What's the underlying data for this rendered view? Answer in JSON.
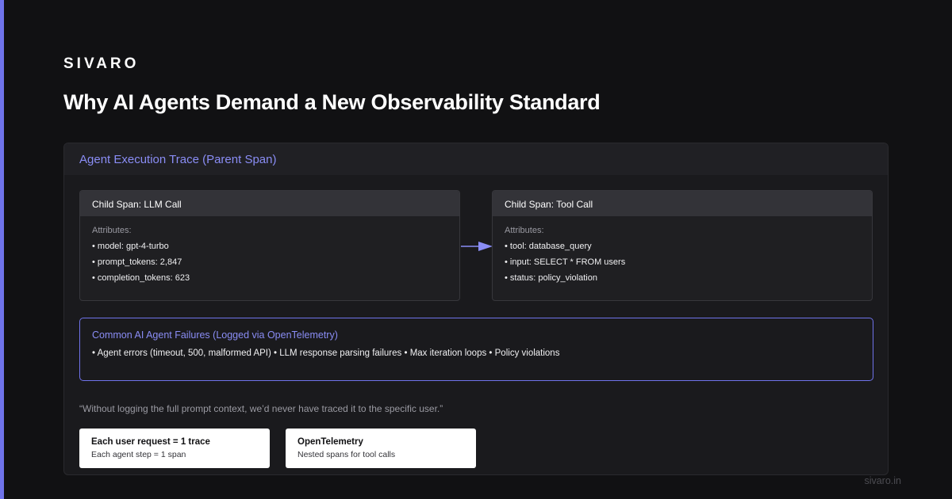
{
  "brand": "SIVARO",
  "headline": "Why AI Agents Demand a New Observability Standard",
  "parent_span": {
    "title": "Agent Execution Trace (Parent Span)"
  },
  "llm_span": {
    "title": "Child Span: LLM Call",
    "attributes_label": "Attributes:",
    "attributes": [
      "• model: gpt-4-turbo",
      "• prompt_tokens: 2,847",
      "• completion_tokens: 623"
    ]
  },
  "tool_span": {
    "title": "Child Span: Tool Call",
    "attributes_label": "Attributes:",
    "attributes": [
      "• tool: database_query",
      "• input: SELECT * FROM users",
      "• status: policy_violation"
    ]
  },
  "failures": {
    "title": "Common AI Agent Failures (Logged via OpenTelemetry)",
    "items": "• Agent errors (timeout, 500, malformed API) • LLM response parsing failures • Max iteration loops • Policy violations"
  },
  "quote": "“Without logging the full prompt context, we’d never have traced it to the specific user.”",
  "cards": [
    {
      "title": "Each user request = 1 trace",
      "subtitle": "Each agent step = 1 span"
    },
    {
      "title": "OpenTelemetry",
      "subtitle": "Nested spans for tool calls"
    }
  ],
  "footer_url": "sivaro.in",
  "colors": {
    "accent": "#6f73ea",
    "accent_text": "#8a8df5",
    "background": "#111113",
    "panel": "#1a1a1d"
  }
}
